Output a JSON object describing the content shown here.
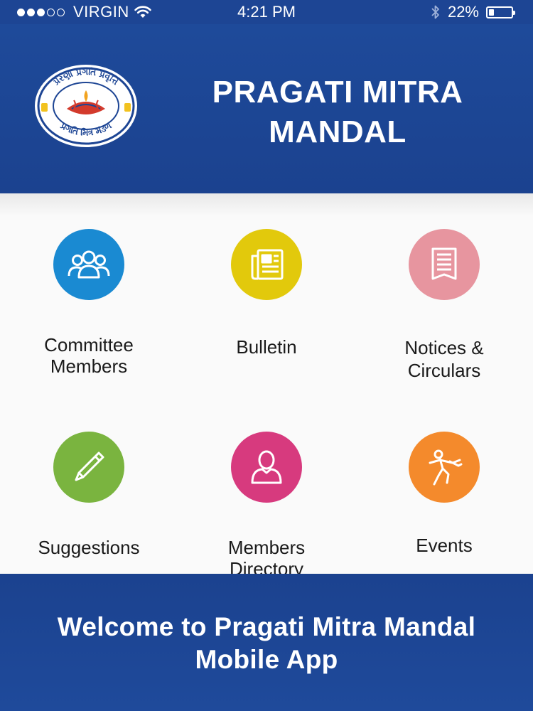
{
  "status_bar": {
    "carrier": "VIRGIN",
    "time": "4:21 PM",
    "battery_percent_label": "22%",
    "battery_level": 0.22,
    "signal_bars_filled": 3,
    "signal_bars_total": 5,
    "icons": [
      "signal-dots-icon",
      "wifi-icon",
      "bluetooth-icon",
      "battery-icon"
    ]
  },
  "header": {
    "title_line1": "PRAGATI MITRA",
    "title_line2": "MANDAL",
    "logo": {
      "name": "pragati-mitra-mandal-logo",
      "text_top": "પ્રેરણા પ્રગતિ પ્રવૃત્તિ",
      "text_bottom": "પ્રગતિ મિત્ર મંડળ"
    }
  },
  "menu": {
    "items": [
      {
        "label_line1": "Committee",
        "label_line2": "Members",
        "icon": "people-icon",
        "color": "#1a8ad2"
      },
      {
        "label_line1": "Bulletin",
        "label_line2": "",
        "icon": "newspaper-icon",
        "color": "#e2c90c"
      },
      {
        "label_line1": "Notices &",
        "label_line2": "Circulars",
        "icon": "document-icon",
        "color": "#e7959f"
      },
      {
        "label_line1": "Suggestions",
        "label_line2": "",
        "icon": "pen-icon",
        "color": "#7ab43f"
      },
      {
        "label_line1": "Members",
        "label_line2": "Directory",
        "icon": "person-icon",
        "color": "#d73a7e"
      },
      {
        "label_line1": "Events",
        "label_line2": "",
        "icon": "dancer-icon",
        "color": "#f48a2c"
      }
    ]
  },
  "footer": {
    "line1": "Welcome to Pragati Mitra Mandal",
    "line2": "Mobile App"
  },
  "colors": {
    "brand_blue": "#1d4594",
    "menu_background": "#fafafa"
  }
}
